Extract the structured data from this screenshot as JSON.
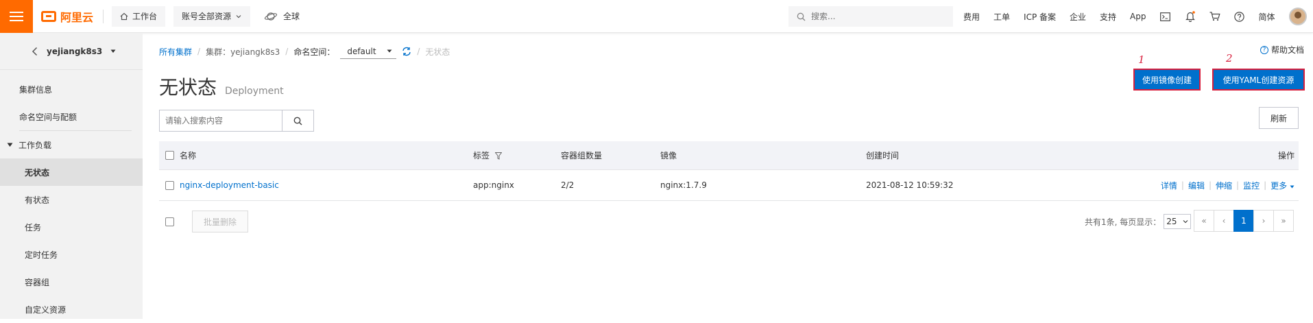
{
  "topbar": {
    "logo_text": "阿里云",
    "workbench": "工作台",
    "resources": "账号全部资源",
    "region": "全球",
    "search_placeholder": "搜索...",
    "links": [
      "费用",
      "工单",
      "ICP 备案",
      "企业",
      "支持",
      "App"
    ],
    "lang": "简体",
    "icons": [
      "terminal-icon",
      "bell-icon",
      "cart-icon",
      "help-icon"
    ]
  },
  "sidebar": {
    "cluster_name": "yejiangk8s3",
    "items_top": [
      "集群信息",
      "命名空间与配额"
    ],
    "group_label": "工作负载",
    "group_items": [
      "无状态",
      "有状态",
      "任务",
      "定时任务",
      "容器组",
      "自定义资源"
    ],
    "active_item": "无状态"
  },
  "breadcrumb": {
    "all_clusters": "所有集群",
    "cluster": "集群：yejiangk8s3",
    "namespace_label": "命名空间：",
    "namespace_value": "default",
    "current": "无状态"
  },
  "help_label": "帮助文档",
  "page": {
    "title": "无状态",
    "subtitle": "Deployment"
  },
  "actions": {
    "create_by_image": "使用镜像创建",
    "create_by_yaml": "使用YAML创建资源",
    "annotation_1": "1",
    "annotation_2": "2",
    "refresh": "刷新",
    "batch_delete": "批量删除"
  },
  "search": {
    "placeholder": "请输入搜索内容"
  },
  "table": {
    "headers": {
      "name": "名称",
      "label": "标签",
      "pods": "容器组数量",
      "image": "镜像",
      "created": "创建时间",
      "ops": "操作"
    },
    "rows": [
      {
        "name": "nginx-deployment-basic",
        "label": "app:nginx",
        "pods": "2/2",
        "image": "nginx:1.7.9",
        "created": "2021-08-12 10:59:32",
        "ops": [
          "详情",
          "编辑",
          "伸缩",
          "监控",
          "更多"
        ]
      }
    ]
  },
  "pagination": {
    "summary": "共有1条, 每页显示：",
    "page_size": "25",
    "unit": "条",
    "first": "«",
    "prev": "‹",
    "current": "1",
    "next": "›",
    "last": "»"
  }
}
